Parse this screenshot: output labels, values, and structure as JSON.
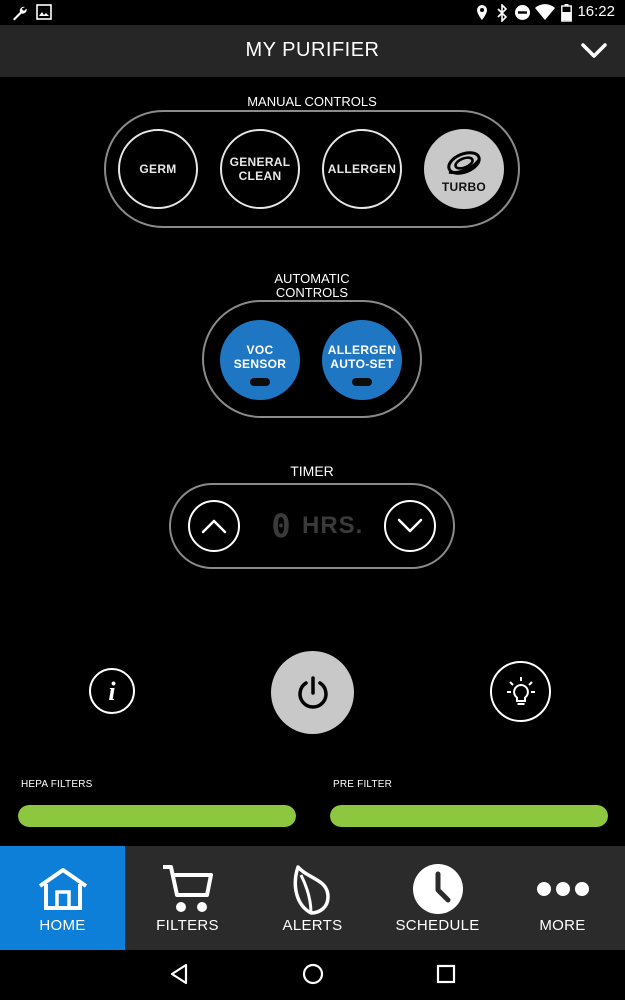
{
  "status_bar": {
    "time": "16:22",
    "left_icons": [
      "wrench-icon",
      "image-icon"
    ],
    "right_icons": [
      "location-icon",
      "bluetooth-icon",
      "do-not-disturb-icon",
      "wifi-icon",
      "battery-icon"
    ]
  },
  "header": {
    "title": "MY PURIFIER",
    "chevron_icon": "chevron-down-icon"
  },
  "manual_controls": {
    "label": "MANUAL CONTROLS",
    "buttons": [
      {
        "label_line1": "GERM",
        "label_line2": ""
      },
      {
        "label_line1": "GENERAL",
        "label_line2": "CLEAN"
      },
      {
        "label_line1": "ALLERGEN",
        "label_line2": ""
      },
      {
        "label_line1": "TURBO",
        "label_line2": "",
        "icon": "turbo-swirl-icon",
        "selected": true
      }
    ]
  },
  "automatic_controls": {
    "label_line1": "AUTOMATIC",
    "label_line2": "CONTROLS",
    "buttons": [
      {
        "label_line1": "VOC",
        "label_line2": "SENSOR"
      },
      {
        "label_line1": "ALLERGEN",
        "label_line2": "AUTO-SET"
      }
    ]
  },
  "timer": {
    "label": "TIMER",
    "value": "0",
    "unit": "HRS.",
    "up_icon": "chevron-up-icon",
    "down_icon": "chevron-down-icon"
  },
  "actions": {
    "info_icon": "info-icon",
    "power_icon": "power-icon",
    "light_icon": "lightbulb-icon"
  },
  "filters": {
    "hepa": {
      "label": "HEPA FILTERS",
      "level": 1.0
    },
    "pre": {
      "label": "PRE FILTER",
      "level": 1.0
    }
  },
  "bottom_nav": [
    {
      "label": "HOME",
      "icon": "home-icon",
      "active": true
    },
    {
      "label": "FILTERS",
      "icon": "cart-icon",
      "active": false
    },
    {
      "label": "ALERTS",
      "icon": "leaf-icon",
      "active": false
    },
    {
      "label": "SCHEDULE",
      "icon": "clock-icon",
      "active": false
    },
    {
      "label": "MORE",
      "icon": "more-icon",
      "active": false
    }
  ],
  "colors": {
    "accent_blue": "#0d7fd8",
    "filter_green": "#8dc63f",
    "header_bg": "#262626",
    "nav_bg": "#2b2b2b"
  }
}
